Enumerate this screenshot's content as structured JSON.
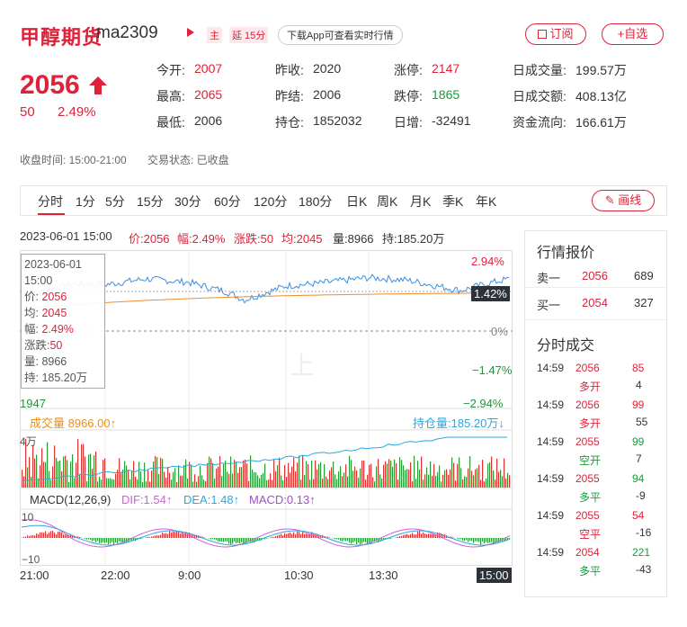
{
  "header": {
    "name": "甲醇期货",
    "code": "ma2309",
    "tag_main": "主",
    "tag_delay": "延 15分",
    "app_btn": "下载App可查看实时行情",
    "subscribe": "订阅",
    "watchlist": "+自选"
  },
  "quote": {
    "price": "2056",
    "change": "50",
    "change_pct": "2.49%",
    "stats": [
      {
        "label": "今开:",
        "value": "2007",
        "color": "red"
      },
      {
        "label": "昨收:",
        "value": "2020",
        "color": "normal"
      },
      {
        "label": "涨停:",
        "value": "2147",
        "color": "red"
      },
      {
        "label": "日成交量:",
        "value": "199.57万",
        "color": "normal"
      },
      {
        "label": "最高:",
        "value": "2065",
        "color": "red"
      },
      {
        "label": "昨结:",
        "value": "2006",
        "color": "normal"
      },
      {
        "label": "跌停:",
        "value": "1865",
        "color": "green"
      },
      {
        "label": "日成交额:",
        "value": "408.13亿",
        "color": "normal"
      },
      {
        "label": "最低:",
        "value": "2006",
        "color": "normal"
      },
      {
        "label": "持仓:",
        "value": "1852032",
        "color": "normal"
      },
      {
        "label": "日增:",
        "value": "-32491",
        "color": "normal"
      },
      {
        "label": "资金流向:",
        "value": "166.61万",
        "color": "normal"
      }
    ],
    "close_time": "收盘时间:  15:00-21:00",
    "trade_status": "交易状态:  已收盘"
  },
  "tabs": [
    "分时",
    "1分",
    "5分",
    "15分",
    "30分",
    "60分",
    "120分",
    "180分",
    "日K",
    "周K",
    "月K",
    "季K",
    "年K"
  ],
  "draw_button": "画线",
  "infobar": {
    "datetime": "2023-06-01 15:00",
    "price": "价:2056",
    "amp": "幅:2.49%",
    "chg": "涨跌:50",
    "avg": "均:2045",
    "vol": "量:8966",
    "oi": "持:185.20万"
  },
  "tooltip": {
    "date": "2023-06-01",
    "time": "15:00",
    "price_l": "价:",
    "price_v": "2056",
    "avg_l": "均:",
    "avg_v": "2045",
    "amp_l": "幅:",
    "amp_v": "2.49%",
    "chg_l": "涨跌:",
    "chg_v": "50",
    "vol": "量: 8966",
    "oi": "持: 185.20万"
  },
  "chart_labels": {
    "pct_top": "2.94%",
    "pct_cur": "1.42%",
    "pct_zero": "0%",
    "pct_m1": "−1.47%",
    "pct_bot": "−2.94%",
    "price_bot": "1947",
    "vol_label": "成交量  8966.00↑",
    "oi_label": "持仓量:185.20万↓",
    "vol_axis": "4万",
    "macd_title": "MACD(12,26,9)",
    "dif": "DIF:1.54↑",
    "dea": "DEA:1.48↑",
    "macd": "MACD:0.13↑",
    "macd_top": "10",
    "macd_bot": "−10",
    "times": [
      "21:00",
      "22:00",
      "9:00",
      "10:30",
      "13:30",
      "15:00"
    ],
    "watermark": "上"
  },
  "chart_data": {
    "type": "line",
    "title": "",
    "x": [
      "21:00",
      "22:00",
      "9:00",
      "10:30",
      "13:30",
      "15:00"
    ],
    "series": [
      {
        "name": "价",
        "values": [
          2007,
          2048,
          2054,
          2042,
          2055,
          2056
        ]
      },
      {
        "name": "均",
        "values": [
          2010,
          2030,
          2040,
          2042,
          2045,
          2045
        ]
      }
    ],
    "ylim": [
      1947,
      2079
    ],
    "reference": 2020
  },
  "panel": {
    "title1": "行情报价",
    "sell_l": "卖一",
    "sell_p": "2056",
    "sell_v": "689",
    "buy_l": "买一",
    "buy_p": "2054",
    "buy_v": "327",
    "title2": "分时成交",
    "trades": [
      {
        "time": "14:59",
        "price": "2056",
        "vol": "85",
        "type": "多开",
        "oi": "4",
        "pc": "red",
        "vc": "red"
      },
      {
        "time": "14:59",
        "price": "2056",
        "vol": "99",
        "type": "多开",
        "oi": "55",
        "pc": "red",
        "vc": "red"
      },
      {
        "time": "14:59",
        "price": "2055",
        "vol": "99",
        "type": "空开",
        "oi": "7",
        "pc": "red",
        "vc": "green"
      },
      {
        "time": "14:59",
        "price": "2055",
        "vol": "94",
        "type": "多平",
        "oi": "-9",
        "pc": "red",
        "vc": "green"
      },
      {
        "time": "14:59",
        "price": "2055",
        "vol": "54",
        "type": "空平",
        "oi": "-16",
        "pc": "red",
        "vc": "red"
      },
      {
        "time": "14:59",
        "price": "2054",
        "vol": "221",
        "type": "多平",
        "oi": "-43",
        "pc": "red",
        "vc": "green"
      }
    ]
  }
}
